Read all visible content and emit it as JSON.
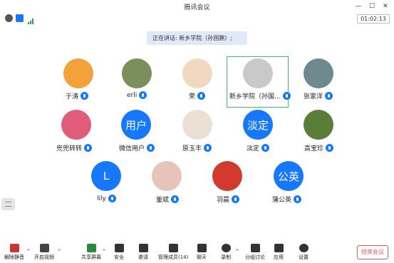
{
  "window": {
    "title": "腾讯会议",
    "minimize": "—",
    "maximize": "☐",
    "close": "✕"
  },
  "status": {
    "timer": "01:02:13"
  },
  "speaking_banner": "正在讲话: 新乡学院（孙国鹏）;",
  "participants": [
    {
      "name": "于涛",
      "avatar_type": "image",
      "color": "#f3a23a"
    },
    {
      "name": "erli",
      "avatar_type": "image",
      "color": "#7a8f5a"
    },
    {
      "name": "荣",
      "avatar_type": "image",
      "color": "#f1d9c0"
    },
    {
      "name": "新乡学院（孙国...",
      "avatar_type": "image",
      "color": "#c9c9c9"
    },
    {
      "name": "张家洋",
      "avatar_type": "image",
      "color": "#6f8a8e"
    },
    {
      "name": "兜兜转转",
      "avatar_type": "image",
      "color": "#e05c7a"
    },
    {
      "name": "微信用户",
      "avatar_type": "text",
      "avatar_text": "用户"
    },
    {
      "name": "原玉丰",
      "avatar_type": "image",
      "color": "#eae0d4"
    },
    {
      "name": "淡定",
      "avatar_type": "text",
      "avatar_text": "淡定"
    },
    {
      "name": "高宝珍",
      "avatar_type": "image",
      "color": "#5b7d3a"
    },
    {
      "name": "lily",
      "avatar_type": "text",
      "avatar_text": "L"
    },
    {
      "name": "董斌",
      "avatar_type": "image",
      "color": "#e8c4b8"
    },
    {
      "name": "羽晨",
      "avatar_type": "image",
      "color": "#d23a2e"
    },
    {
      "name": "蒲公英",
      "avatar_type": "text",
      "avatar_text": "公英"
    }
  ],
  "toolbar": {
    "unmute": "解除静音",
    "start_video": "开启视频",
    "share_screen": "共享屏幕",
    "security": "安全",
    "invite": "邀请",
    "manage_members": "管理成员(14)",
    "chat": "聊天",
    "record": "录制",
    "breakout": "分组讨论",
    "apps": "应用",
    "settings": "设置",
    "end_meeting": "结束会议"
  },
  "colors": {
    "accent": "#1677ff",
    "active_border": "#36c26b",
    "end": "#e25c5c",
    "banner_bg": "#dfe9f7"
  }
}
